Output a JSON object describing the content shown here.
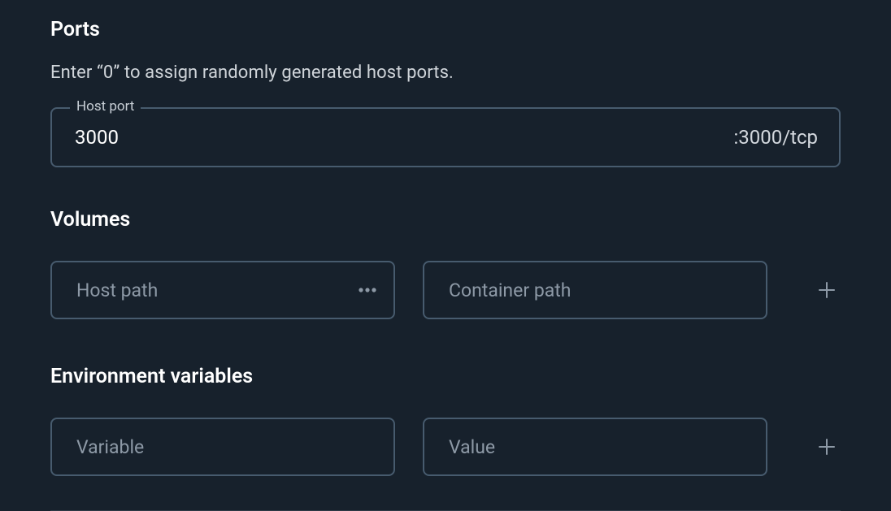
{
  "ports": {
    "title": "Ports",
    "help": "Enter “0” to assign randomly generated host ports.",
    "host_port_label": "Host port",
    "host_port_value": "3000",
    "container_port_label": ":3000/tcp"
  },
  "volumes": {
    "title": "Volumes",
    "host_path_placeholder": "Host path",
    "container_path_placeholder": "Container path"
  },
  "env": {
    "title": "Environment variables",
    "variable_placeholder": "Variable",
    "value_placeholder": "Value"
  }
}
